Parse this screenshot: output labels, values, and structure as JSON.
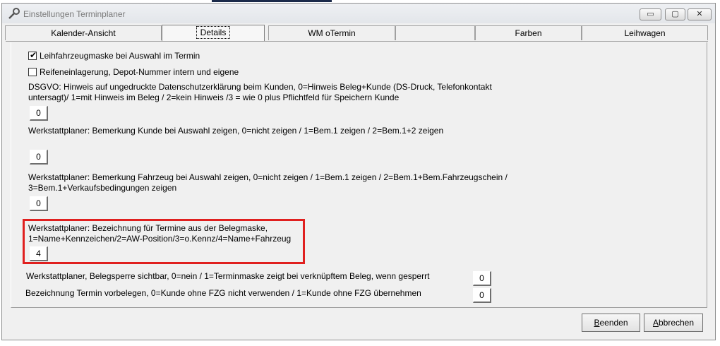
{
  "window": {
    "title": "Einstellungen Terminplaner"
  },
  "controls": {
    "minimize": "▭",
    "maximize": "▢",
    "close": "✕"
  },
  "tabs": [
    {
      "label": "Kalender-Ansicht"
    },
    {
      "label": "Details"
    },
    {
      "label": "WM oTermin"
    },
    {
      "label": ""
    },
    {
      "label": "Farben"
    },
    {
      "label": "Leihwagen"
    }
  ],
  "details": {
    "cb1": {
      "label": "Leihfahrzeugmaske bei Auswahl im Termin",
      "checked": true
    },
    "cb2": {
      "label": "Reifeneinlagerung, Depot-Nummer intern und eigene",
      "checked": false
    },
    "dsgvo": {
      "line1": "DSGVO: Hinweis auf ungedruckte Datenschutzerklärung beim Kunden, 0=Hinweis Beleg+Kunde (DS-Druck, Telefonkontakt",
      "line2": "untersagt)/ 1=mit Hinweis im Beleg / 2=kein Hinweis /3 = wie 0 plus Pflichtfeld für Speichern Kunde",
      "value": "0"
    },
    "bem_kunde": {
      "line1": "Werkstattplaner: Bemerkung Kunde bei Auswahl zeigen, 0=nicht zeigen / 1=Bem.1 zeigen / 2=Bem.1+2 zeigen",
      "value": "0"
    },
    "bem_fzg": {
      "line1": "Werkstattplaner: Bemerkung Fahrzeug bei Auswahl zeigen, 0=nicht zeigen / 1=Bem.1 zeigen / 2=Bem.1+Bem.Fahrzeugschein /",
      "line2": "3=Bem.1+Verkaufsbedingungen zeigen",
      "value": "0"
    },
    "bezeichnung": {
      "line1": "Werkstattplaner: Bezeichnung für Termine aus der Belegmaske,",
      "line2": "1=Name+Kennzeichen/2=AW-Position/3=o.Kennz/4=Name+Fahrzeug",
      "value": "4"
    },
    "belegsperre": {
      "line1": "Werkstattplaner, Belegsperre sichtbar, 0=nein / 1=Terminmaske zeigt bei verknüpftem Beleg, wenn gesperrt",
      "value": "0"
    },
    "vorbelegen": {
      "line1": "Bezeichnung Termin vorbelegen, 0=Kunde ohne FZG nicht verwenden / 1=Kunde ohne FZG übernehmen",
      "value": "0"
    }
  },
  "buttons": {
    "beenden": {
      "first": "B",
      "rest": "eenden"
    },
    "abbrechen": {
      "first": "A",
      "rest": "bbrechen"
    }
  },
  "colors": {
    "highlight": "#e0201f",
    "dialog_bg": "#f0f0f0"
  }
}
